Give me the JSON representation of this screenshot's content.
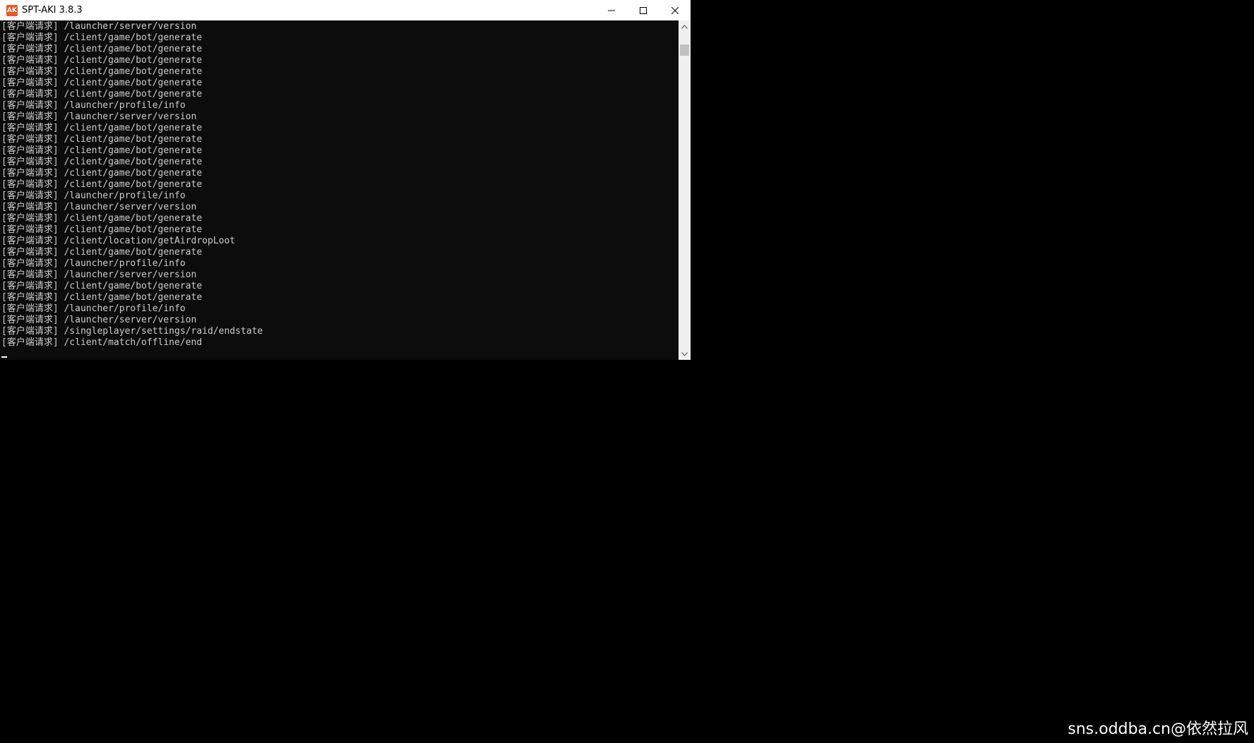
{
  "window": {
    "title": "SPT-AKI 3.8.3",
    "icon": "spt-aki-app-icon",
    "icon_glyph": "AK",
    "controls": [
      "minimize-icon",
      "maximize-icon",
      "close-icon"
    ]
  },
  "console": {
    "lines": [
      "[客户端请求] /launcher/server/version",
      "[客户端请求] /client/game/bot/generate",
      "[客户端请求] /client/game/bot/generate",
      "[客户端请求] /client/game/bot/generate",
      "[客户端请求] /client/game/bot/generate",
      "[客户端请求] /client/game/bot/generate",
      "[客户端请求] /client/game/bot/generate",
      "[客户端请求] /launcher/profile/info",
      "[客户端请求] /launcher/server/version",
      "[客户端请求] /client/game/bot/generate",
      "[客户端请求] /client/game/bot/generate",
      "[客户端请求] /client/game/bot/generate",
      "[客户端请求] /client/game/bot/generate",
      "[客户端请求] /client/game/bot/generate",
      "[客户端请求] /client/game/bot/generate",
      "[客户端请求] /launcher/profile/info",
      "[客户端请求] /launcher/server/version",
      "[客户端请求] /client/game/bot/generate",
      "[客户端请求] /client/game/bot/generate",
      "[客户端请求] /client/location/getAirdropLoot",
      "[客户端请求] /client/game/bot/generate",
      "[客户端请求] /launcher/profile/info",
      "[客户端请求] /launcher/server/version",
      "[客户端请求] /client/game/bot/generate",
      "[客户端请求] /client/game/bot/generate",
      "[客户端请求] /launcher/profile/info",
      "[客户端请求] /launcher/server/version",
      "[客户端请求] /singleplayer/settings/raid/endstate",
      "[客户端请求] /client/match/offline/end"
    ]
  },
  "colors": {
    "console_bg": "#0c0c0c",
    "console_text": "#cccccc",
    "titlebar_bg": "#ffffff",
    "scrollbar_bg": "#f0f0f0"
  },
  "watermark": "sns.oddba.cn@依然拉风"
}
